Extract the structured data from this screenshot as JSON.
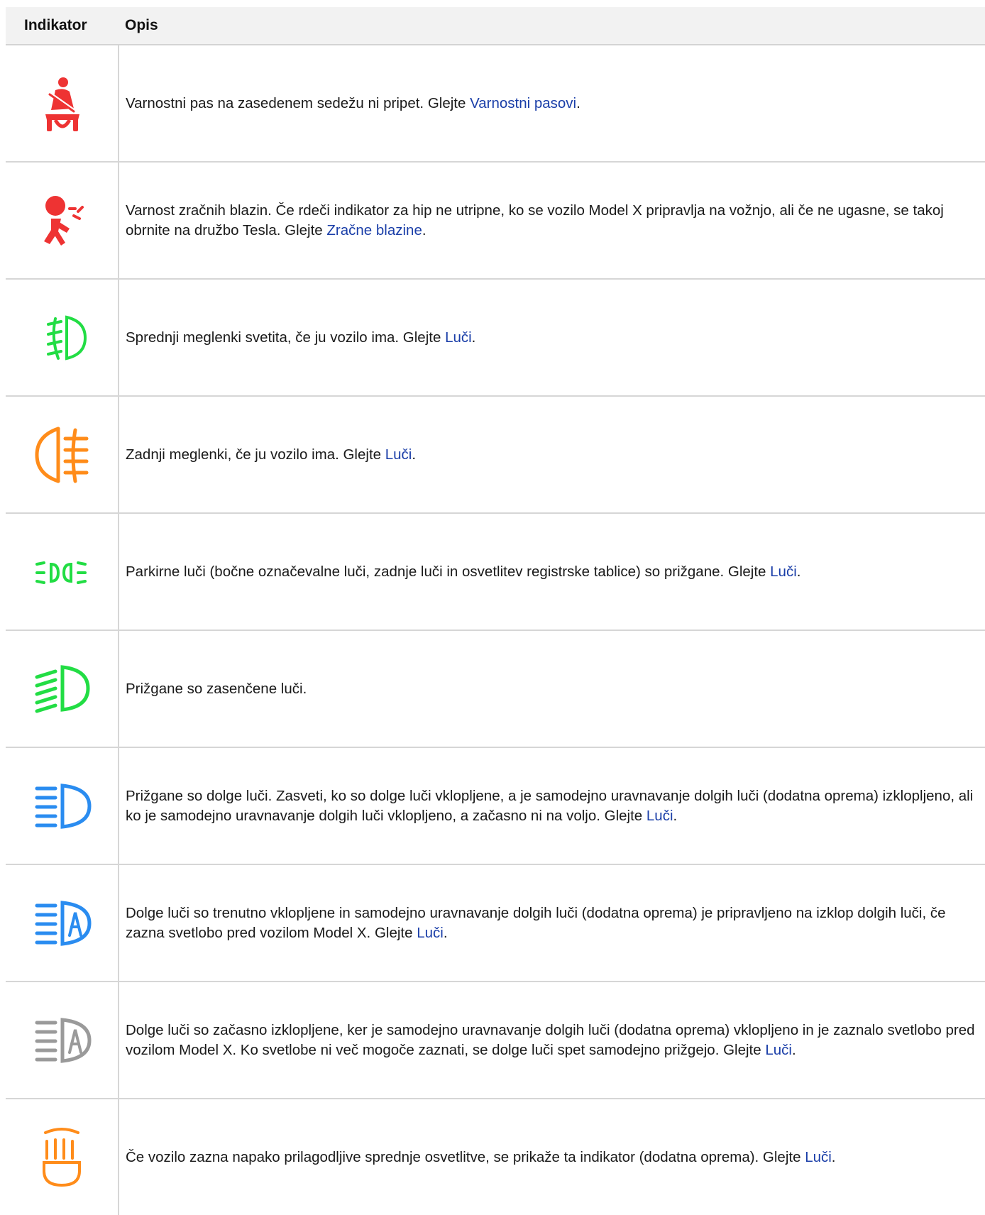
{
  "header": {
    "indicator": "Indikator",
    "description": "Opis"
  },
  "colors": {
    "red": "#ee3333",
    "green": "#22dd44",
    "orange": "#ff8c1a",
    "blue": "#2a8cf0",
    "gray": "#9a9a9a",
    "link": "#1a3ea8"
  },
  "rows": [
    {
      "icon": "seatbelt-warning-icon",
      "text": "Varnostni pas na zasedenem sedežu ni pripet. Glejte ",
      "link": "Varnostni pasovi",
      "after": "."
    },
    {
      "icon": "airbag-warning-icon",
      "text": "Varnost zračnih blazin. Če rdeči indikator za hip ne utripne, ko se vozilo Model X pripravlja na vožnjo, ali če ne ugasne, se takoj obrnite na družbo Tesla. Glejte ",
      "link": "Zračne blazine",
      "after": "."
    },
    {
      "icon": "front-fog-lights-icon",
      "text": "Sprednji meglenki svetita, če ju vozilo ima. Glejte ",
      "link": "Luči",
      "after": "."
    },
    {
      "icon": "rear-fog-lights-icon",
      "text": "Zadnji meglenki, če ju vozilo ima. Glejte ",
      "link": "Luči",
      "after": "."
    },
    {
      "icon": "parking-lights-icon",
      "text": "Parkirne luči (bočne označevalne luči, zadnje luči in osvetlitev registrske tablice) so prižgane. Glejte ",
      "link": "Luči",
      "after": "."
    },
    {
      "icon": "low-beam-icon",
      "text": "Prižgane so zasenčene luči.",
      "link": "",
      "after": ""
    },
    {
      "icon": "high-beam-icon",
      "text": "Prižgane so dolge luči. Zasveti, ko so dolge luči vklopljene, a je samodejno uravnavanje dolgih luči (dodatna oprema) izklopljeno, ali ko je samodejno uravnavanje dolgih luči vklopljeno, a začasno ni na voljo. Glejte ",
      "link": "Luči",
      "after": "."
    },
    {
      "icon": "auto-high-beam-active-icon",
      "text": "Dolge luči so trenutno vklopljene in samodejno uravnavanje dolgih luči (dodatna oprema) je pripravljeno na izklop dolgih luči, če zazna svetlobo pred vozilom Model X. Glejte ",
      "link": "Luči",
      "after": "."
    },
    {
      "icon": "auto-high-beam-inactive-icon",
      "text": "Dolge luči so začasno izklopljene, ker je samodejno uravnavanje dolgih luči (dodatna oprema) vklopljeno in je zaznalo svetlobo pred vozilom Model X. Ko svetlobe ni več mogoče zaznati, se dolge luči spet samodejno prižgejo. Glejte ",
      "link": "Luči",
      "after": "."
    },
    {
      "icon": "adaptive-headlight-fault-icon",
      "text": "Če vozilo zazna napako prilagodljive sprednje osvetlitve, se prikaže ta indikator (dodatna oprema). Glejte ",
      "link": "Luči",
      "after": "."
    }
  ]
}
